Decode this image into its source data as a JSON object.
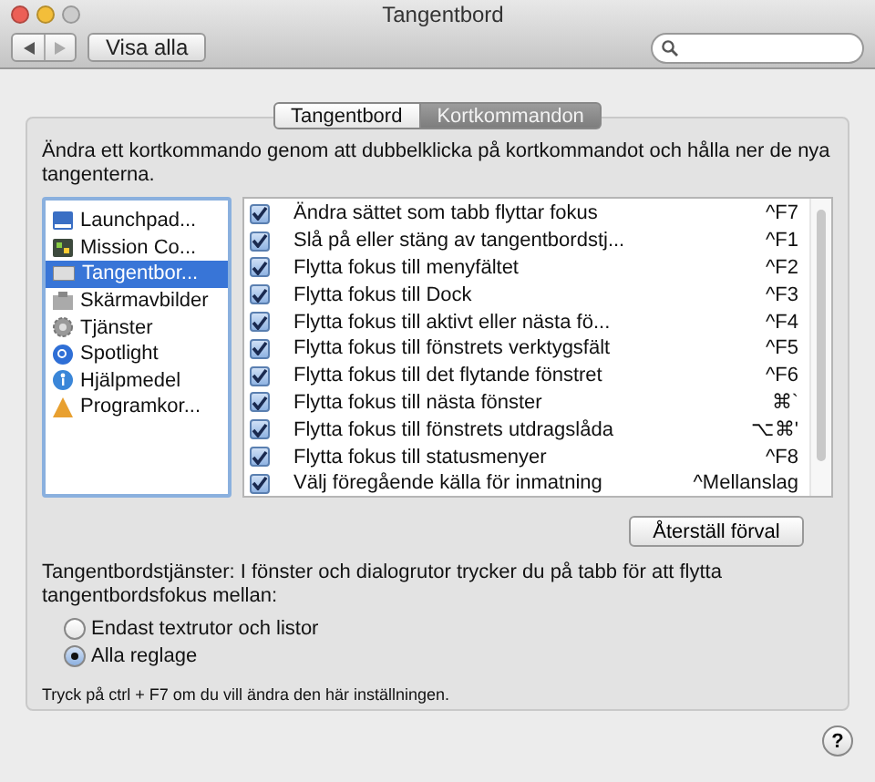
{
  "window": {
    "title": "Tangentbord"
  },
  "toolbar": {
    "show_all": "Visa alla"
  },
  "tabs": [
    {
      "label": "Tangentbord",
      "selected": false
    },
    {
      "label": "Kortkommandon",
      "selected": true
    }
  ],
  "instruction": "Ändra ett kortkommando genom att dubbelklicka på kortkommandot och hålla ner de nya tangenterna.",
  "categories": [
    {
      "label": "Launchpad...",
      "selected": false
    },
    {
      "label": "Mission Co...",
      "selected": false
    },
    {
      "label": "Tangentbor...",
      "selected": true
    },
    {
      "label": "Skärmavbilder",
      "selected": false
    },
    {
      "label": "Tjänster",
      "selected": false
    },
    {
      "label": "Spotlight",
      "selected": false
    },
    {
      "label": "Hjälpmedel",
      "selected": false
    },
    {
      "label": "Programkor...",
      "selected": false
    }
  ],
  "shortcuts": [
    {
      "label": "Ändra sättet som tabb flyttar fokus",
      "keys": "^F7",
      "checked": true
    },
    {
      "label": "Slå på eller stäng av tangentbordstj...",
      "keys": "^F1",
      "checked": true
    },
    {
      "label": "Flytta fokus till menyfältet",
      "keys": "^F2",
      "checked": true
    },
    {
      "label": "Flytta fokus till Dock",
      "keys": "^F3",
      "checked": true
    },
    {
      "label": "Flytta fokus till aktivt eller nästa fö...",
      "keys": "^F4",
      "checked": true
    },
    {
      "label": "Flytta fokus till fönstrets verktygsfält",
      "keys": "^F5",
      "checked": true
    },
    {
      "label": "Flytta fokus till det flytande fönstret",
      "keys": "^F6",
      "checked": true
    },
    {
      "label": "Flytta fokus till nästa fönster",
      "keys": "⌘`",
      "checked": true
    },
    {
      "label": "Flytta fokus till fönstrets utdragslåda",
      "keys": "⌥⌘'",
      "checked": true
    },
    {
      "label": "Flytta fokus till statusmenyer",
      "keys": "^F8",
      "checked": true
    },
    {
      "label": "Välj föregående källa för inmatning",
      "keys": "^Mellanslag",
      "checked": true
    }
  ],
  "restore_button": "Återställ förval",
  "focus_text": "Tangentbordstjänster: I fönster och dialogrutor trycker du på tabb för att flytta tangentbordsfokus mellan:",
  "focus_options": [
    {
      "label": "Endast textrutor och listor",
      "selected": false
    },
    {
      "label": "Alla reglage",
      "selected": true
    }
  ],
  "note": "Tryck på ctrl + F7 om du vill ändra den här inställningen.",
  "help": "?"
}
